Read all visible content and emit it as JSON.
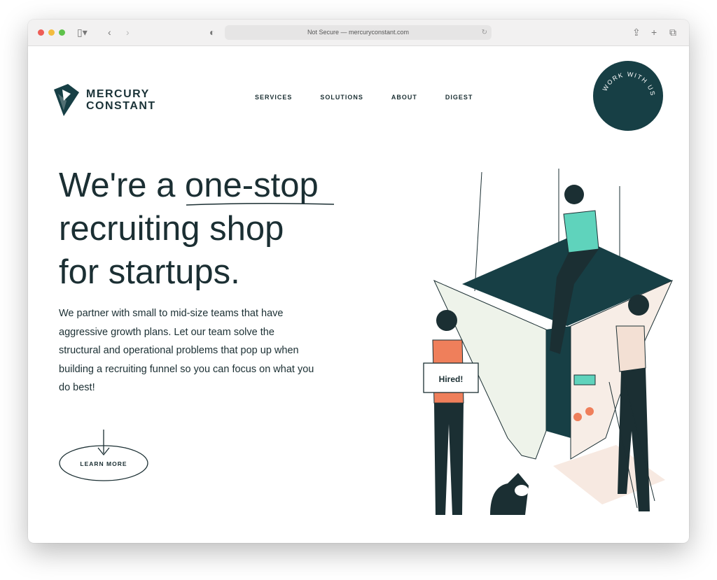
{
  "browser": {
    "url": "Not Secure — mercuryconstant.com"
  },
  "logo": {
    "line1": "MERCURY",
    "line2": "CONSTANT"
  },
  "nav": [
    "SERVICES",
    "SOLUTIONS",
    "ABOUT",
    "DIGEST"
  ],
  "cta": "WORK WITH US",
  "hero": {
    "title_pre": "We're a ",
    "title_underlined": "one-stop",
    "title_line2": "recruiting shop",
    "title_line3": "for startups.",
    "body": "We partner with small to mid-size teams that have aggressive growth plans. Let our team solve the structural and operational problems that pop up when building a recruiting funnel so you can focus on what you do best!",
    "button": "LEARN MORE"
  },
  "illustration": {
    "sign": "Hired!"
  },
  "colors": {
    "brand": "#173f45",
    "accent": "#5fd3bc",
    "orange": "#ef7f5b",
    "ink": "#1b2f33"
  }
}
